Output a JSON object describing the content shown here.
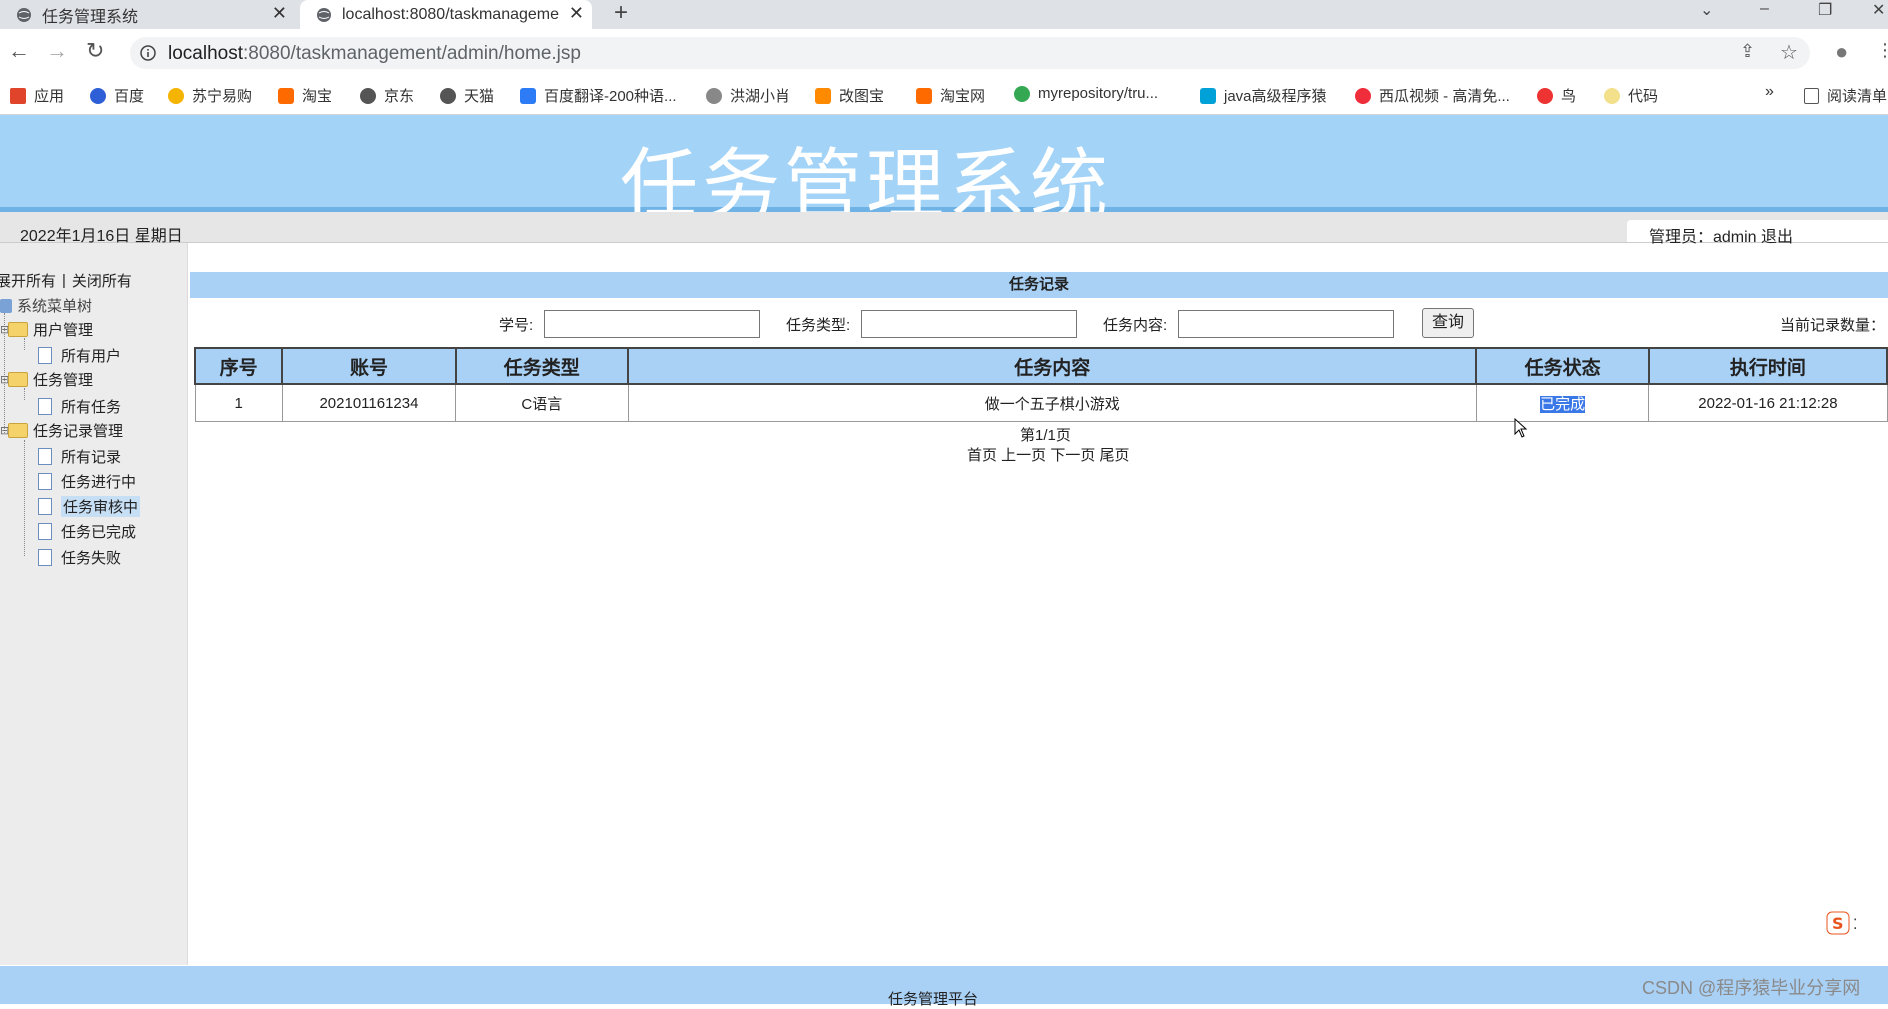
{
  "browser": {
    "tabs": [
      {
        "title": "任务管理系统"
      },
      {
        "title": "localhost:8080/taskmanageme"
      }
    ],
    "new_tab": "+",
    "address": {
      "host": "localhost",
      "path": ":8080/taskmanagement/admin/home.jsp"
    },
    "bookmarks": [
      {
        "label": "应用",
        "color": "#e0442b"
      },
      {
        "label": "百度",
        "color": "#2e5fd6"
      },
      {
        "label": "苏宁易购",
        "color": "#f5b400"
      },
      {
        "label": "淘宝",
        "color": "#ff6a00"
      },
      {
        "label": "京东",
        "color": "#555555"
      },
      {
        "label": "天猫",
        "color": "#555555"
      },
      {
        "label": "百度翻译-200种语...",
        "color": "#2e7bf6"
      },
      {
        "label": "洪湖小肖",
        "color": "#888888"
      },
      {
        "label": "改图宝",
        "color": "#ff8a00"
      },
      {
        "label": "淘宝网",
        "color": "#ff6a00"
      },
      {
        "label": "myrepository/tru...",
        "color": "#34a853"
      },
      {
        "label": "java高级程序猿",
        "color": "#00a1d6"
      },
      {
        "label": "西瓜视频 - 高清免...",
        "color": "#f02d3a"
      },
      {
        "label": "鸟",
        "color": "#e33"
      },
      {
        "label": "代码",
        "color": "#f3e08a"
      }
    ],
    "reading_list": "阅读清单",
    "more": "»"
  },
  "header": {
    "title": "任务管理系统",
    "date": "2022年1月16日 星期日",
    "admin_text": "管理员：admin 退出"
  },
  "sidebar": {
    "expand_all": "展开所有",
    "separator": "|",
    "collapse_all": "关闭所有",
    "root": "系统菜单树",
    "groups": [
      {
        "label": "用户管理",
        "items": [
          "所有用户"
        ]
      },
      {
        "label": "任务管理",
        "items": [
          "所有任务"
        ]
      },
      {
        "label": "任务记录管理",
        "items": [
          "所有记录",
          "任务进行中",
          "任务审核中",
          "任务已完成",
          "任务失败"
        ]
      }
    ],
    "selected": "任务审核中"
  },
  "main": {
    "title": "任务记录",
    "filters": {
      "student_id": "学号:",
      "task_type": "任务类型:",
      "task_content": "任务内容:",
      "query_button": "查询",
      "record_count": "当前记录数量："
    },
    "table": {
      "columns": [
        "序号",
        "账号",
        "任务类型",
        "任务内容",
        "任务状态",
        "执行时间"
      ],
      "rows": [
        [
          "1",
          "202101161234",
          "C语言",
          "做一个五子棋小游戏",
          "已完成",
          "2022-01-16 21:12:28"
        ]
      ]
    },
    "pager": {
      "page_info": "第1/1页",
      "links": "首页 上一页 下一页 尾页"
    }
  },
  "footer": {
    "text": "任务管理平台"
  },
  "watermark": "CSDN @程序猿毕业分享网",
  "colors": {
    "banner": "#a3d3f7",
    "header_row": "#a9d0f5",
    "selection": "#3b78e7"
  }
}
